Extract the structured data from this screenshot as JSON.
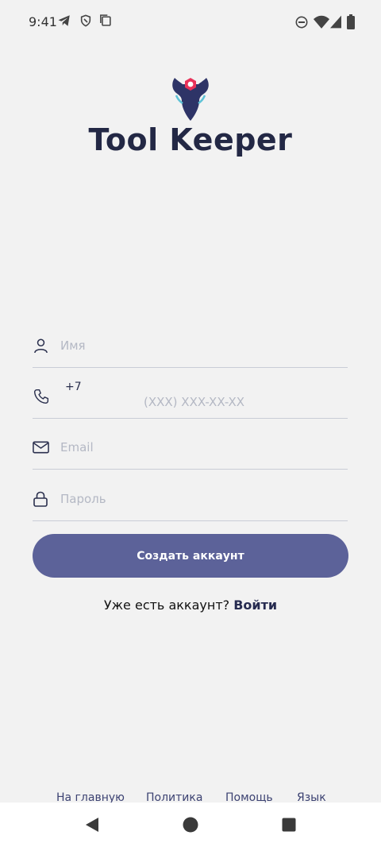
{
  "status_bar": {
    "time": "9:41",
    "left_icons": [
      "telegram-icon",
      "vpn-shield-icon",
      "copy-icon"
    ],
    "right_icons": [
      "do-not-disturb-icon",
      "wifi-icon",
      "signal-icon",
      "battery-icon"
    ]
  },
  "app": {
    "title": "Tool Keeper",
    "accent_color": "#5c6299",
    "logo_color": "#2e3467",
    "logo_nut_color": "#e8325a"
  },
  "form": {
    "name": {
      "placeholder": "Имя",
      "icon": "person-icon"
    },
    "phone": {
      "country_code": "+7",
      "placeholder": "(XXX) XXX-XX-XX",
      "icon": "phone-icon"
    },
    "email": {
      "placeholder": "Email",
      "icon": "mail-icon"
    },
    "password": {
      "placeholder": "Пароль",
      "icon": "lock-icon"
    },
    "submit_label": "Создать аккаунт"
  },
  "login_prompt": {
    "text": "Уже есть аккаунт?",
    "link": "Войти"
  },
  "footer": {
    "links": [
      "На главную",
      "Политика",
      "Помощь",
      "Язык"
    ]
  },
  "nav_bar": {
    "icons": [
      "back-triangle-icon",
      "home-circle-icon",
      "recents-square-icon"
    ]
  }
}
